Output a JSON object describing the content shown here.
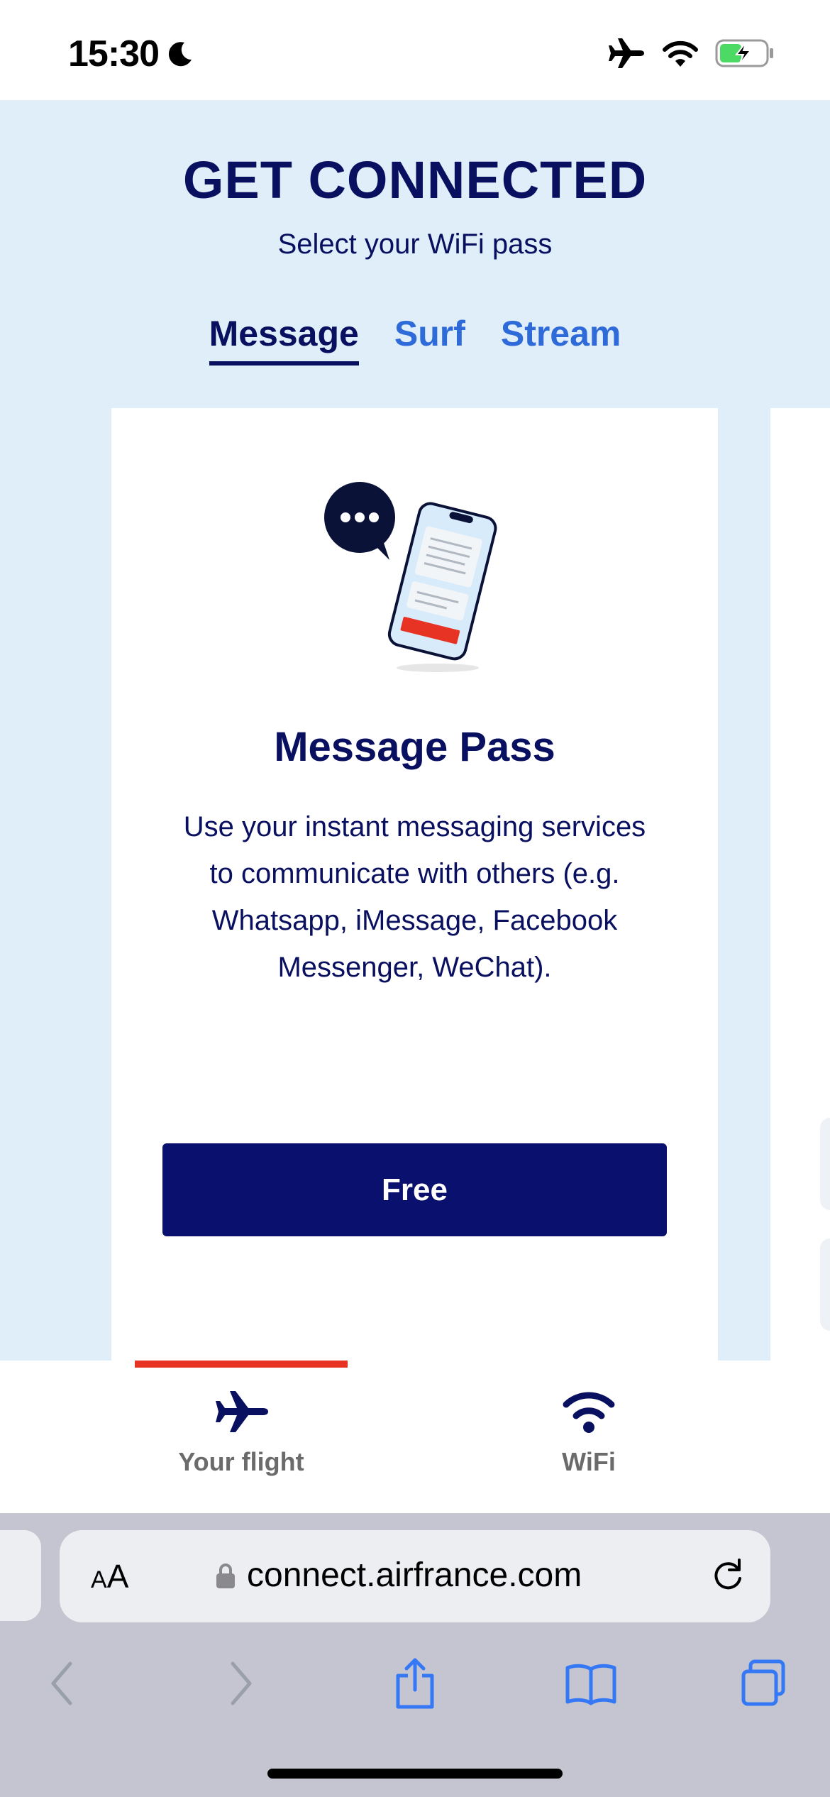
{
  "status_bar": {
    "time": "15:30",
    "icons": [
      "moon-icon",
      "airplane-mode-icon",
      "wifi-icon",
      "battery-charging-icon"
    ]
  },
  "hero": {
    "title": "GET CONNECTED",
    "subtitle": "Select your WiFi pass"
  },
  "tabs": [
    {
      "label": "Message",
      "active": true
    },
    {
      "label": "Surf",
      "active": false
    },
    {
      "label": "Stream",
      "active": false
    }
  ],
  "card": {
    "title": "Message Pass",
    "description": "Use your instant messaging services to communicate with others (e.g. Whatsapp, iMessage, Facebook Messenger, WeChat).",
    "button_label": "Free",
    "illustration": "chat-phone-illustration"
  },
  "app_nav": {
    "items": [
      {
        "label": "Your flight",
        "icon": "airplane-icon",
        "active": true
      },
      {
        "label": "WiFi",
        "icon": "wifi-icon",
        "active": false
      }
    ]
  },
  "browser": {
    "aa_label_small": "A",
    "aa_label_large": "A",
    "url": "connect.airfrance.com",
    "toolbar_icons": [
      "back-icon",
      "forward-icon",
      "share-icon",
      "bookmarks-icon",
      "tabs-icon"
    ]
  },
  "colors": {
    "brand_navy": "#0a1060",
    "accent_blue": "#2f6ad9",
    "accent_red": "#e63323",
    "hero_bg": "#e0eefa"
  }
}
